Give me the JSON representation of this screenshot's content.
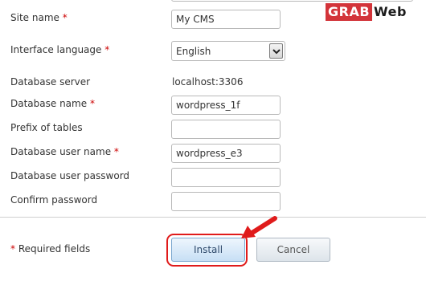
{
  "form": {
    "site_name": {
      "label": "Site name",
      "required_mark": "*",
      "value": "My CMS"
    },
    "interface_language": {
      "label": "Interface language",
      "required_mark": "*",
      "value": "English"
    },
    "database_server": {
      "label": "Database server",
      "value": "localhost:3306"
    },
    "database_name": {
      "label": "Database name",
      "required_mark": "*",
      "value": "wordpress_1f"
    },
    "table_prefix": {
      "label": "Prefix of tables",
      "value": ""
    },
    "db_user_name": {
      "label": "Database user name",
      "required_mark": "*",
      "value": "wordpress_e3"
    },
    "db_user_password": {
      "label": "Database user password",
      "value": ""
    },
    "confirm_password": {
      "label": "Confirm password",
      "value": ""
    }
  },
  "footer": {
    "required_mark": "*",
    "required_note": "Required fields",
    "install_label": "Install",
    "cancel_label": "Cancel"
  },
  "watermark": {
    "part1": "GRAB",
    "part2": "Web"
  },
  "colors": {
    "required_star": "#cc0000",
    "highlight": "#e01b1b",
    "install_bg": "#c7dff5"
  },
  "icons": {
    "select_arrow": "chevron-down-icon",
    "annotation": "red-arrow-icon"
  }
}
